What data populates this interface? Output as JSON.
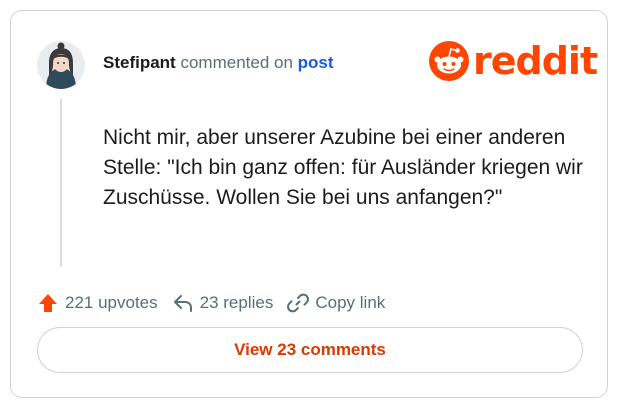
{
  "comment": {
    "username": "Stefipant",
    "action_text": "commented on",
    "post_link": "post",
    "body": "Nicht mir, aber unserer Azubine bei einer anderen Stelle: \"Ich bin ganz offen: für Ausländer kriegen wir Zuschüsse. Wollen Sie bei uns anfangen?\""
  },
  "brand": {
    "wordmark": "reddit",
    "icon": "reddit-snoo-icon",
    "color": "#ff4500"
  },
  "actions": {
    "upvotes_label": "221 upvotes",
    "replies_label": "23 replies",
    "copy_link_label": "Copy link"
  },
  "footer": {
    "view_comments_label": "View 23 comments"
  },
  "colors": {
    "accent": "#ff4500",
    "link": "#1a5bd6",
    "button_text": "#d93a00",
    "meta_text": "#576f76"
  }
}
